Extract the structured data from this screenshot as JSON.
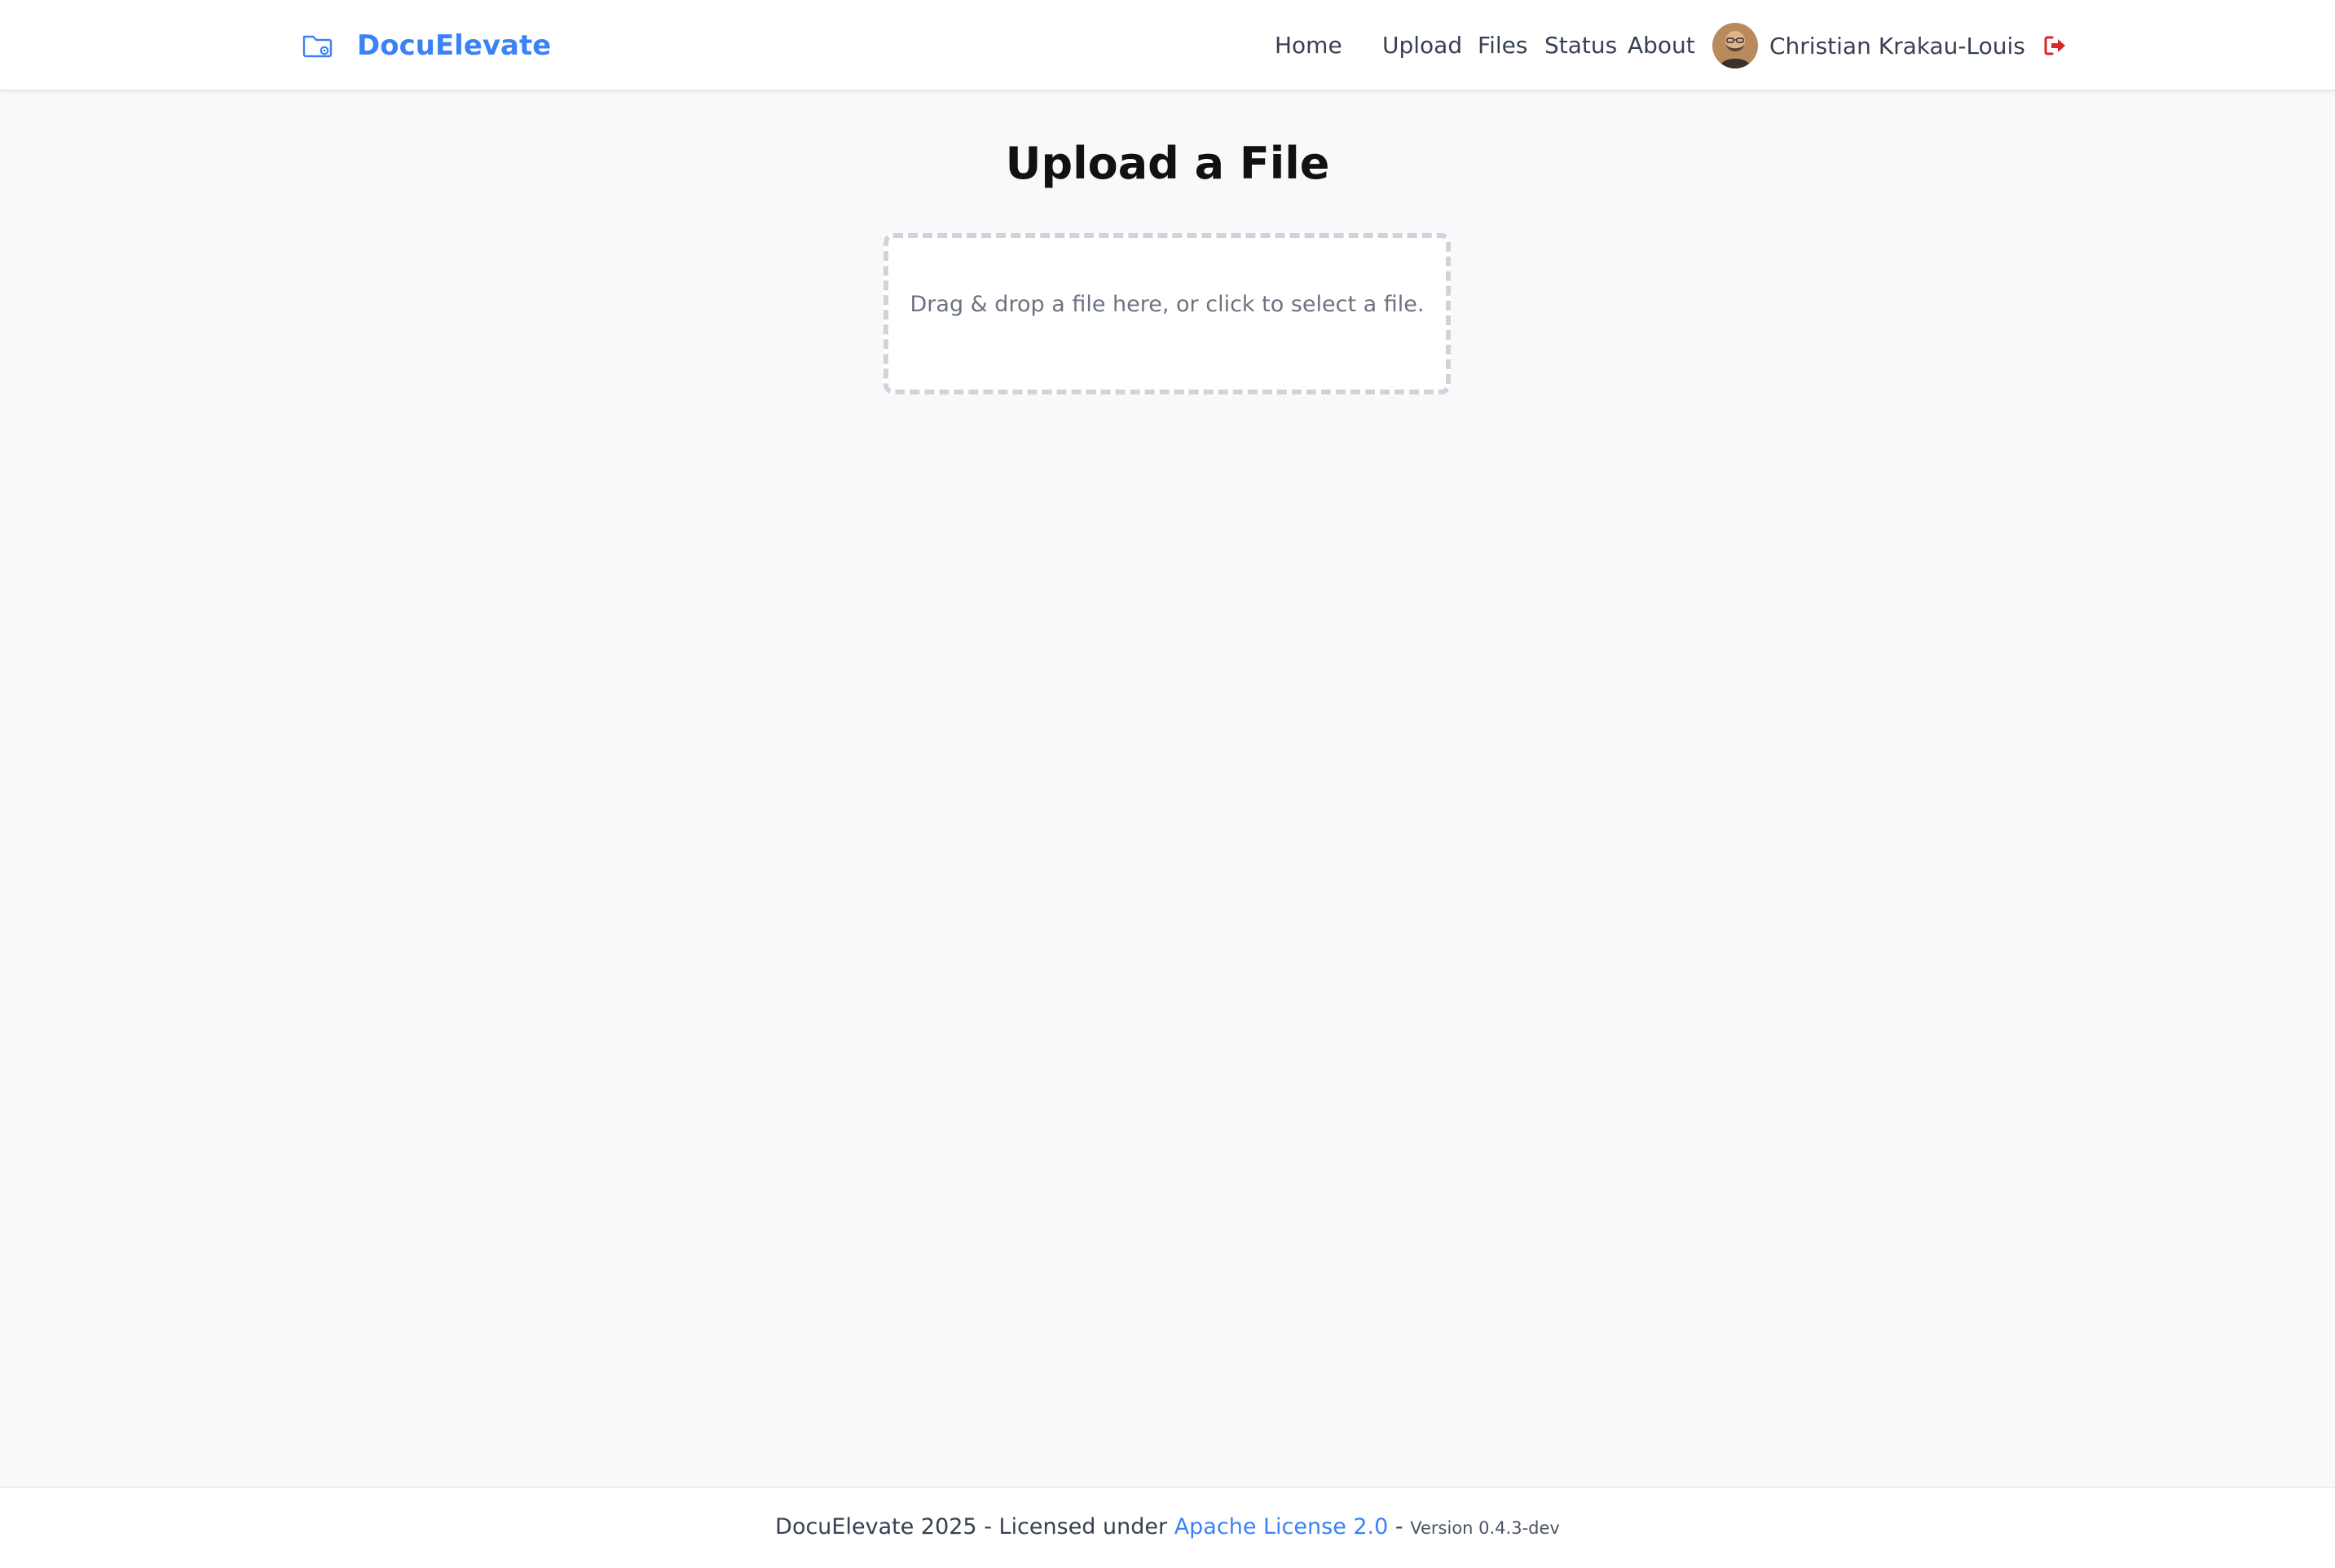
{
  "app": {
    "name": "DocuElevate",
    "brand_color": "#3b82f6"
  },
  "nav": {
    "items": [
      {
        "label": "Home"
      },
      {
        "label": "Upload"
      },
      {
        "label": "Files"
      },
      {
        "label": "Status"
      },
      {
        "label": "About"
      }
    ],
    "user": {
      "name": "Christian Krakau-Louis",
      "avatar_icon": "user-avatar",
      "logout_icon": "logout-icon",
      "logout_color": "#dc2626"
    }
  },
  "main": {
    "title": "Upload a File",
    "dropzone_text": "Drag & drop a file here, or click to select a file."
  },
  "footer": {
    "prefix": "DocuElevate 2025 - Licensed under ",
    "license_link": "Apache License 2.0",
    "separator": " - ",
    "version": "Version 0.4.3-dev"
  }
}
